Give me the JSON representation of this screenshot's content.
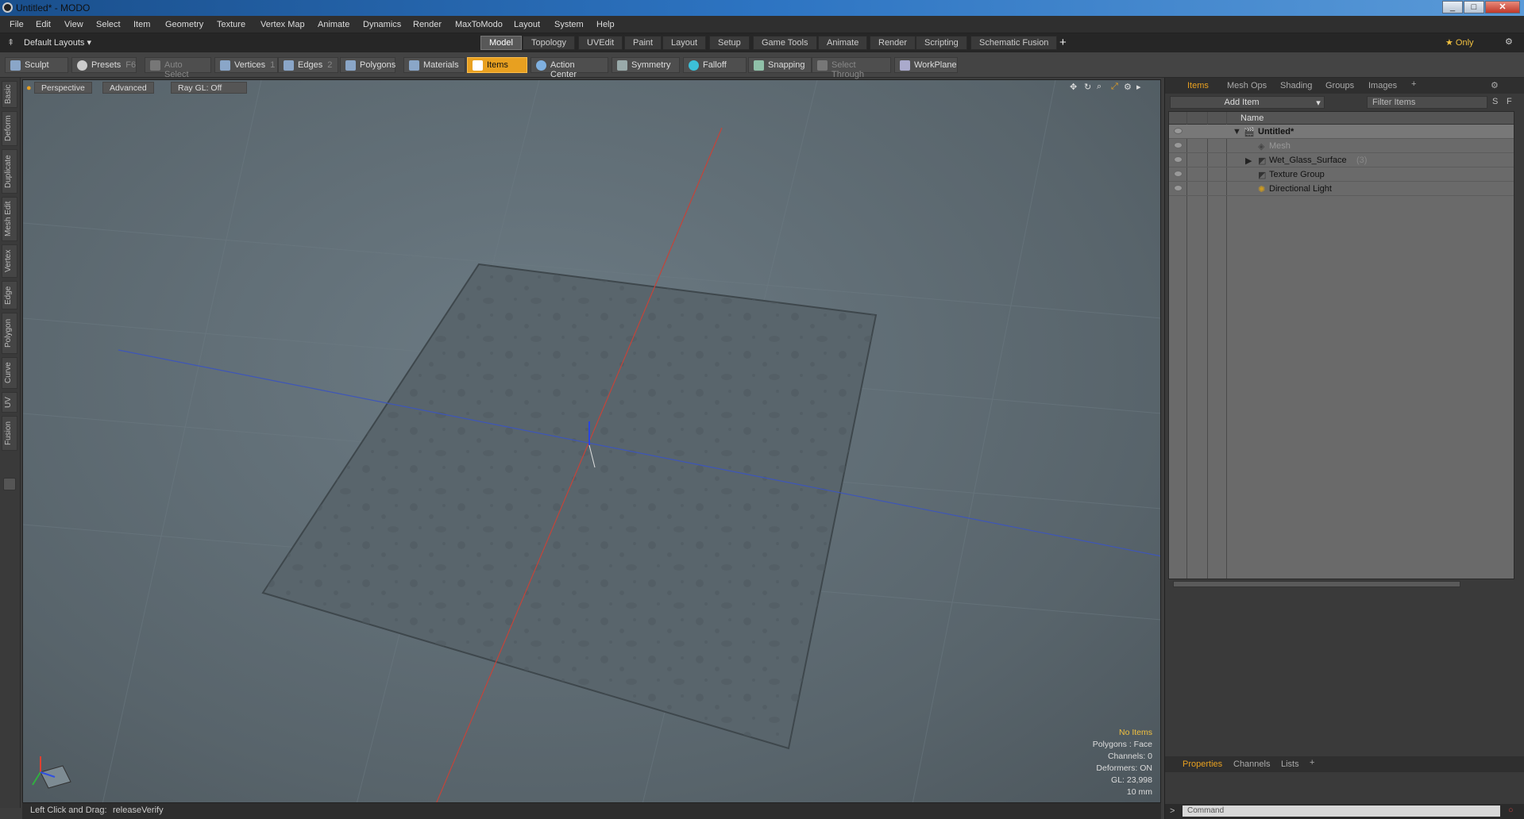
{
  "window": {
    "title": "Untitled* - MODO",
    "min": "_",
    "max": "□",
    "close": "✕"
  },
  "menu": [
    "File",
    "Edit",
    "View",
    "Select",
    "Item",
    "Geometry",
    "Texture",
    "Vertex Map",
    "Animate",
    "Dynamics",
    "Render",
    "MaxToModo",
    "Layout",
    "System",
    "Help"
  ],
  "layout_selector": "Default Layouts ▾",
  "mode_tabs": [
    {
      "label": "Model",
      "active": true
    },
    {
      "label": "Topology"
    },
    {
      "label": "UVEdit"
    },
    {
      "label": "Paint"
    },
    {
      "label": "Layout"
    },
    {
      "label": "Setup"
    },
    {
      "label": "Game Tools"
    },
    {
      "label": "Animate"
    },
    {
      "label": "Render"
    },
    {
      "label": "Scripting"
    },
    {
      "label": "Schematic Fusion"
    }
  ],
  "add_tab": "+",
  "only_button": "★ Only",
  "toolbar": {
    "sculpt": "Sculpt",
    "presets": "Presets",
    "presets_key": "F6",
    "auto_select": "Auto Select",
    "vertices": "Vertices",
    "vertices_key": "1",
    "edges": "Edges",
    "edges_key": "2",
    "polygons": "Polygons",
    "materials": "Materials",
    "items": "Items",
    "action_center": "Action Center",
    "symmetry": "Symmetry",
    "falloff": "Falloff",
    "snapping": "Snapping",
    "select_through": "Select Through",
    "workplane": "WorkPlane"
  },
  "left_tabs": [
    "Basic",
    "Deform",
    "Duplicate",
    "Mesh Edit",
    "Vertex",
    "Edge",
    "Polygon",
    "Curve",
    "UV",
    "Fusion"
  ],
  "viewport": {
    "perspective": "Perspective",
    "advanced": "Advanced",
    "raygl": "Ray GL: Off",
    "stats": {
      "no_items": "No Items",
      "polygons": "Polygons : Face",
      "channels": "Channels: 0",
      "deformers": "Deformers: ON",
      "gl": "GL: 23,998",
      "units": "10 mm"
    },
    "accent": "#e8a020"
  },
  "status": {
    "hint": "Left Click and Drag:",
    "action": "releaseVerify"
  },
  "right_panel": {
    "tabs": [
      "Items",
      "Mesh Ops",
      "Shading",
      "Groups",
      "Images"
    ],
    "add_item": "Add Item",
    "filter": "Filter Items",
    "filter_s": "S",
    "filter_f": "F",
    "col_name": "Name",
    "items": [
      {
        "name": "Untitled*",
        "bold": true
      },
      {
        "name": "Mesh",
        "dim": true
      },
      {
        "name": "Wet_Glass_Surface",
        "count": "(3)"
      },
      {
        "name": "Texture Group"
      },
      {
        "name": "Directional Light"
      }
    ],
    "bottom_tabs": [
      "Properties",
      "Channels",
      "Lists"
    ],
    "command_placeholder": "Command",
    "prompt": ">"
  }
}
